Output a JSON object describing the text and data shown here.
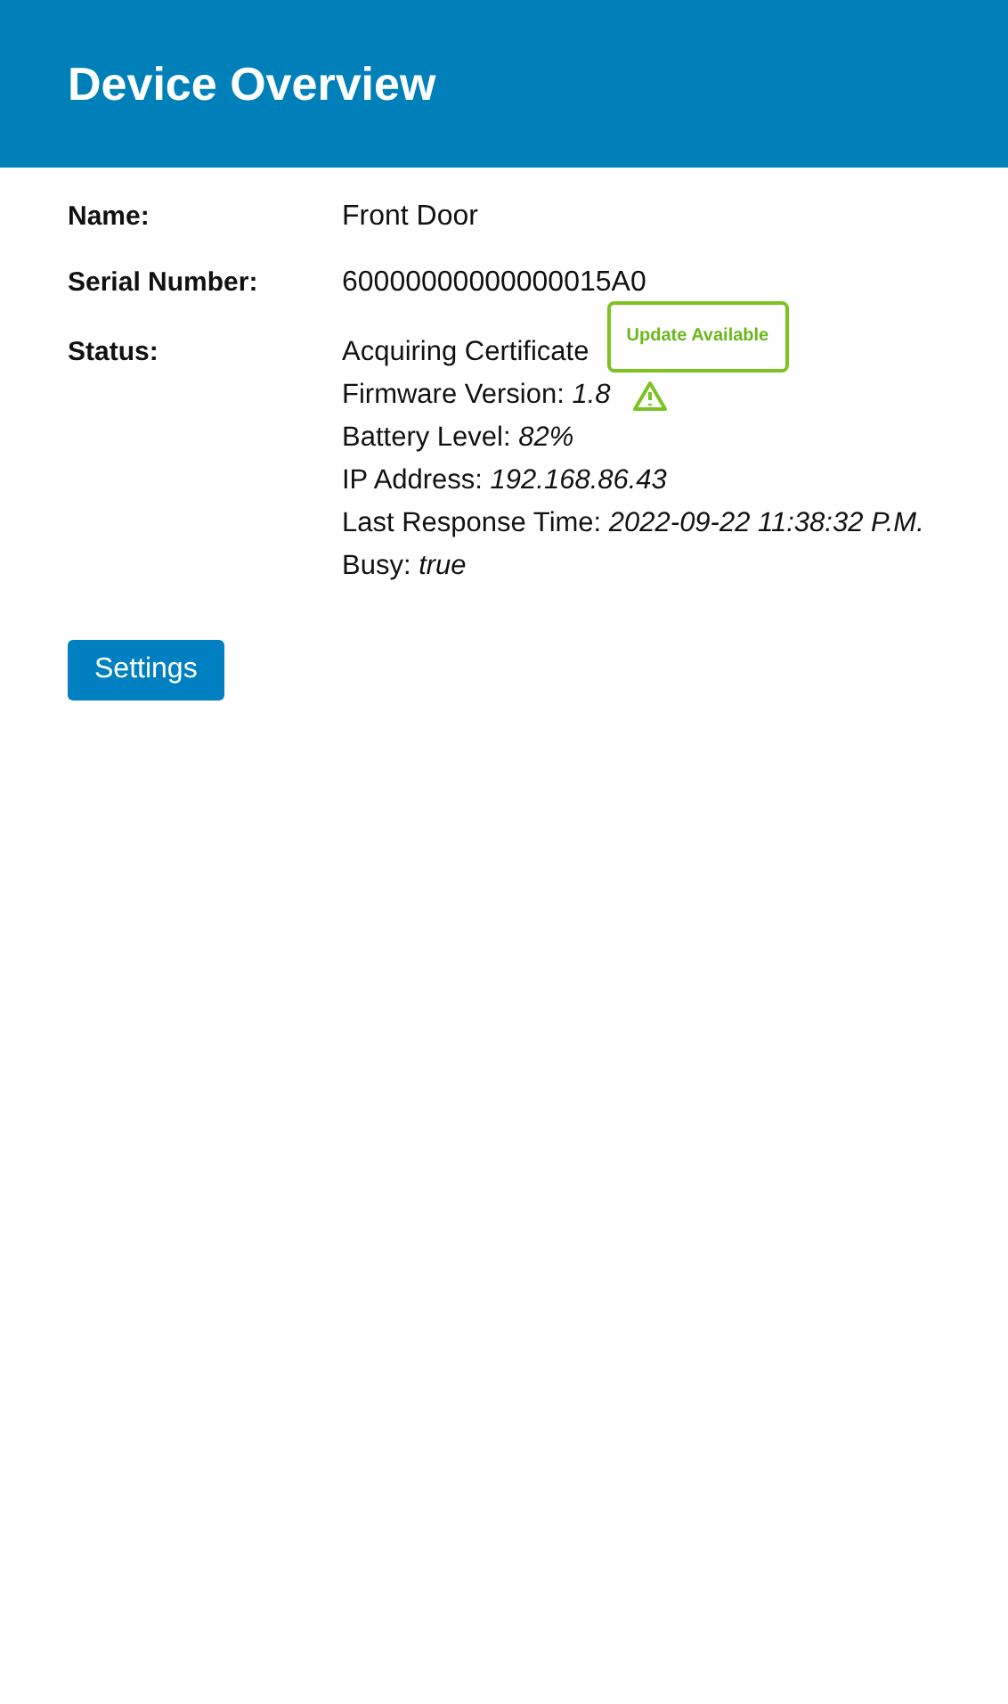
{
  "header": {
    "title": "Device Overview"
  },
  "fields": [
    {
      "label": "Name:",
      "value": "Front Door"
    },
    {
      "label": "Serial Number:",
      "value": "60000000000000015A0"
    }
  ],
  "status": {
    "label": "Status:",
    "lines": [
      {
        "kind": "plain",
        "text": "Acquiring Certificate"
      },
      {
        "kind": "pair",
        "label": "Firmware Version:",
        "value": "1.8",
        "warning": {
          "tooltip": "Update Available"
        }
      },
      {
        "kind": "pair",
        "label": "Battery Level:",
        "value": "82%"
      },
      {
        "kind": "pair",
        "label": "IP Address:",
        "value": "192.168.86.43"
      },
      {
        "kind": "pair",
        "label": "Last Response Time:",
        "value": "2022-09-22 11:38:32 P.M."
      },
      {
        "kind": "pair",
        "label": "Busy:",
        "value": "true"
      }
    ]
  },
  "buttons": [
    {
      "label": "Settings"
    }
  ]
}
